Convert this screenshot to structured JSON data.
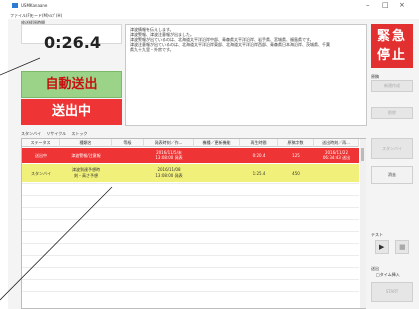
{
  "window": {
    "title": "USMKanaane",
    "minimize_glyph": "–",
    "maximize_glyph": "□",
    "close_glyph": "×"
  },
  "menu": [
    "ファイル(F)",
    "モード(M)",
    "ﾍﾙﾌﾟ(H)"
  ],
  "timer": {
    "label": "放送経過時間",
    "value": "0:26.4"
  },
  "status_buttons": {
    "auto_send": "自動送出",
    "sending": "送出中"
  },
  "message_lines": [
    "津波情報を伝えします。",
    "津波警報、津波注意報が出ました。",
    "津波警報が出ているのは、北海道太平洋沿岸中部、青森県太平洋沿岸、岩手県、宮城県、福島県です。",
    "津波注意報が出ているのは、北海道太平洋沿岸東部、北海道太平洋沿岸西部、青森県日本海沿岸、茨城県、千葉",
    "県九十九里・外房です。"
  ],
  "emergency_stop": {
    "line1": "緊急",
    "line2": "停止"
  },
  "right_panel": {
    "section1_label": "原稿",
    "new_draft": "新規作成",
    "delete": "削除",
    "standby": "スタンバイ",
    "clear": "消去",
    "test_label": "テスト",
    "transmit_label": "送出",
    "time_insert": "□タイム挿入",
    "start": "START",
    "play_glyph": "▶",
    "stop_glyph": "■"
  },
  "tabs": [
    "スタンバイ",
    "リサイクル",
    "ストック"
  ],
  "table": {
    "columns": [
      "ステータス",
      "種類名",
      "等級",
      "発表時刻／作...",
      "機種／更新機能",
      "再生時間",
      "原稿字数",
      "送出時刻／再..."
    ],
    "rows": [
      {
        "status": "送出中",
        "type": "津波警報/注意報",
        "grade": "",
        "announce_line1": "2016/11/5/末",
        "announce_line2": "13:08:00 発表",
        "model": "",
        "duration": "0:20.4",
        "chars": "125",
        "sent_line1": "2016/11/22",
        "sent_line2": "06:34:43 送出",
        "bg": "#ee3434",
        "fg": "#ffffff"
      },
      {
        "status": "スタンバイ",
        "type_line1": "津波到達予想時",
        "type_line2": "刻・高さ予想",
        "grade": "",
        "announce_line1": "2016/11/08",
        "announce_line2": "13:08:00 発表",
        "model": "",
        "duration": "1:25.4",
        "chars": "450",
        "sent_line1": "",
        "sent_line2": "",
        "bg": "#f0f07a",
        "fg": "#333333"
      }
    ]
  },
  "colors": {
    "emergency": "#e23030",
    "auto_send_bg": "#9bd389",
    "sending_bg": "#ee3434",
    "standby_row_bg": "#f0f07a"
  }
}
